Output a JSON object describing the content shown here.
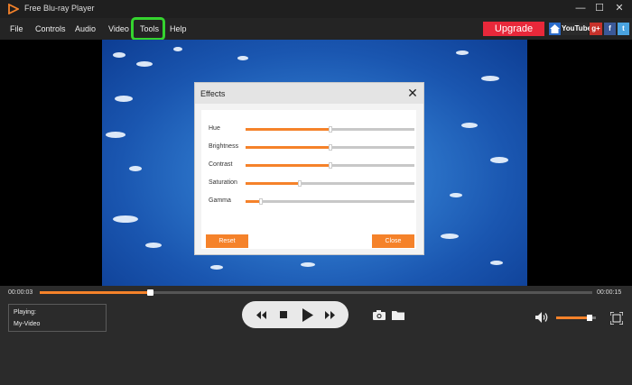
{
  "app": {
    "title": "Free Blu-ray Player",
    "brand_color": "#f5822a",
    "window_controls": {
      "minimize": "—",
      "maximize": "☐",
      "close": "✕"
    }
  },
  "menu": {
    "items": [
      "File",
      "Controls",
      "Audio",
      "Video",
      "Tools",
      "Help"
    ],
    "highlighted": "Tools",
    "upgrade_label": "Upgrade",
    "upgrade_color": "#e8283a",
    "social": {
      "home_icon": "home-icon",
      "youtube": "YouTube",
      "googleplus": "g+",
      "facebook": "f",
      "twitter": "t"
    }
  },
  "effects": {
    "title": "Effects",
    "close_glyph": "✕",
    "sliders": [
      {
        "label": "Hue",
        "value": 0.5
      },
      {
        "label": "Brightness",
        "value": 0.5
      },
      {
        "label": "Contrast",
        "value": 0.5
      },
      {
        "label": "Saturation",
        "value": 0.32
      },
      {
        "label": "Gamma",
        "value": 0.09
      }
    ],
    "reset_label": "Reset",
    "close_label": "Close"
  },
  "playback": {
    "current_time": "00:00:03",
    "total_time": "00:00:15",
    "progress": 0.2,
    "playing_label": "Playing:",
    "file_name": "My-Video",
    "volume": 0.85
  }
}
